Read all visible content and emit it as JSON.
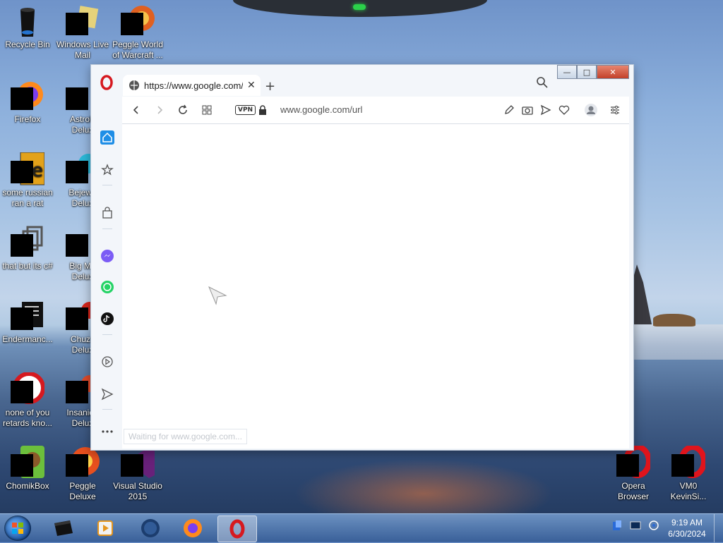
{
  "desktop": {
    "icons": [
      {
        "label": "Recycle Bin",
        "icon": "recycle-bin-icon"
      },
      {
        "label": "Windows Live\nMail",
        "icon": "windows-live-mail-icon"
      },
      {
        "label": "Peggle World\nof Warcraft ...",
        "icon": "peggle-wow-icon"
      },
      {
        "label": "Firefox",
        "icon": "firefox-icon"
      },
      {
        "label": "AstroP\nDelux",
        "icon": "astropop-icon"
      },
      {
        "label": "some russian\nran a rat",
        "icon": "app-icon"
      },
      {
        "label": "Bejewe\nDelux",
        "icon": "bejeweled-icon"
      },
      {
        "label": "that but its c#",
        "icon": "app-icon"
      },
      {
        "label": "Big Mo\nDelux",
        "icon": "big-money-icon"
      },
      {
        "label": "Endermanc...",
        "icon": "app-icon"
      },
      {
        "label": "Chuzz\nDelux",
        "icon": "chuzzle-icon"
      },
      {
        "label": "none of you\nretards kno...",
        "icon": "app-icon"
      },
      {
        "label": "Insaniqu\nDelux",
        "icon": "insaniquarium-icon"
      },
      {
        "label": "ChomikBox",
        "icon": "chomikbox-icon"
      },
      {
        "label": "Peggle Deluxe",
        "icon": "peggle-icon"
      },
      {
        "label": "Visual Studio\n2015",
        "icon": "visual-studio-icon"
      },
      {
        "label": "Opera\nBrowser",
        "icon": "opera-icon"
      },
      {
        "label": "VM0\nKevinSi...",
        "icon": "opera-icon"
      }
    ]
  },
  "browser": {
    "tab_title": "https://www.google.com/u",
    "address": "www.google.com/url",
    "vpn_label": "VPN",
    "status_text": "Waiting for www.google.com...",
    "window_buttons": {
      "minimize": "—",
      "maximize": "□",
      "close": "✕"
    },
    "new_tab_label": "+"
  },
  "taskbar": {
    "apps": [
      "media-center-icon",
      "windows-media-player-icon",
      "app-globe-icon",
      "firefox-icon",
      "opera-icon"
    ],
    "time": "9:19 AM",
    "date": "6/30/2024"
  },
  "colors": {
    "opera_red": "#d6191f",
    "sidebar_accent": "#1f8ee6"
  }
}
